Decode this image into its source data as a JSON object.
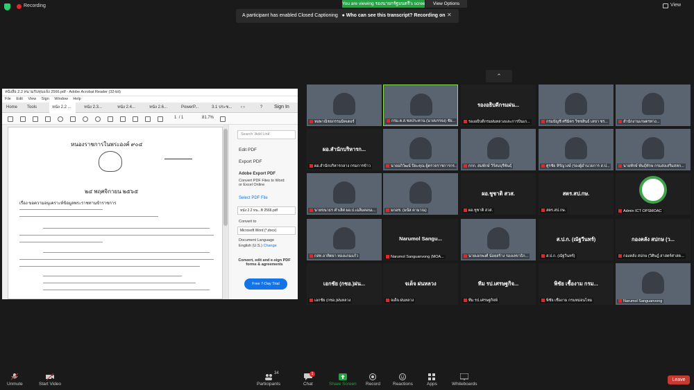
{
  "top": {
    "recording": "Recording",
    "viewing": "You are viewing รองนายกรัฐมนตรี's screen",
    "view_options": "View Options",
    "view": "View",
    "caption_notice": "A participant has enabled Closed Captioning",
    "caption_link": "Who can see this transcript? Recording on"
  },
  "acrobat": {
    "title": "หนังสือ 2.2 หนามรับทุนแจ้ง 2566.pdf - Adobe Acrobat Reader (32-bit)",
    "menu": [
      "File",
      "Edit",
      "View",
      "Sign",
      "Window",
      "Help"
    ],
    "tabs": [
      "Home",
      "Tools",
      "หนัง 2.2 ...",
      "หนัง 2.3...",
      "หนัง 2.4...",
      "หนัง 2.6...",
      "PowerP...",
      "3.1 ประช..."
    ],
    "sign_in": "Sign In",
    "page_current": "1",
    "page_total": "/ 1",
    "zoom": "81.7%",
    "doc_heading": "หนองราชการในพระองค์ ๙๐๔",
    "doc_date": "๒๔ พฤศจิกายน ๒๕๖๕",
    "doc_subject": "เรื่อง ขอความอนุเคราะห์ข้อมูลพระราชทานข้าราชการ",
    "right": {
      "search_placeholder": "Search 'Add Link'",
      "edit_pdf": "Edit PDF",
      "export_pdf": "Export PDF",
      "adobe_export": "Adobe Export PDF",
      "convert_desc": "Convert PDF Files to Word or Excel Online",
      "select_file": "Select PDF File",
      "file_name": "หนัง 2.2 หน...ทิ 2566.pdf",
      "convert_to": "Convert to",
      "format": "Microsoft Word (*.docx)",
      "doc_lang": "Document Language",
      "lang": "English (U.S.)",
      "change": "Change",
      "promo": "Convert, edit and e-sign PDF forms & agreements",
      "free_trial": "Free 7-Day Trial"
    }
  },
  "tiles": [
    {
      "name": "",
      "label": "หอพาณิชยกรรมมิคเตอร์",
      "video": true
    },
    {
      "name": "",
      "label": "กรม.ค.ส.ชลประทาน (นายบรรจง) ชัย...",
      "video": true,
      "highlight": true
    },
    {
      "name": "รองอธิบดีกรมฝน...",
      "label": "รองอธิบดีกรมฝนหลวงและการบินเก..."
    },
    {
      "name": "",
      "label": "กรมบัญชี ศรีมิตร วีชชสินธ์ เลขา ซร...",
      "video": true
    },
    {
      "name": "",
      "label": "สำนักงานเกษตรทาง...",
      "video": true
    },
    {
      "name": "ผอ.สำนักบริหารก...",
      "label": "ผอ.สำนักบริหารกลาง กรมการข้าว"
    },
    {
      "name": "",
      "label": "นายอภิวัฒน์ ปิยะคุณ ผู้ตรวจราชการกร...",
      "video": true
    },
    {
      "name": "",
      "label": "กกก. สมพักษ์ วีร์สมบุรีพันธุ์",
      "video": true
    },
    {
      "name": "",
      "label": "ศูรชัย หิรัญวงษ์ (รองผู้อำนวยการ ส.ป...",
      "video": true
    },
    {
      "name": "",
      "label": "นายทักษ์ พันธุ์ทักษ กรมส่งเสริมสหก...",
      "video": true
    },
    {
      "name": "",
      "label": "นายขนาธร คำเลิศ ผอ.ป.เฉลิมคอนเ...",
      "video": true
    },
    {
      "name": "",
      "label": "มกอช. (มนัส คามาณ)",
      "video": true
    },
    {
      "name": "ผอ.ชูชาติ สวส.",
      "label": "ผอ.ชูชาติ สวส."
    },
    {
      "name": "สตร.สป.กษ.",
      "label": "สตร.สป.กษ."
    },
    {
      "name": "",
      "label": "Admin ICT OPSMOAC",
      "logo": true
    },
    {
      "name": "",
      "label": "กสท.อาทิตยา ทองแกมแก้ว",
      "video": true
    },
    {
      "name": "Narumol Sangu...",
      "label": "Narumol Sanguanvong (MOA..."
    },
    {
      "name": "",
      "label": "นายเอกพงศ์ น้อยสร้าง รองเลขาธิก...",
      "video": true
    },
    {
      "name": "ส.ป.ก. (ณัฐวีนทร์)",
      "label": "ส.ป.ก. (ณัฐวีนทร์)"
    },
    {
      "name": "กองคลัง สปกษ (ว...",
      "label": "กองคลัง สปกษ (วิศิษฎ์ สาสตร์ศาสต..."
    },
    {
      "name": "เอกชัย (กชอ.)ฝน...",
      "label": "เอกชัย (กชอ.)ฝนหลวง"
    },
    {
      "name": "จเด็จ ฝนหลวง",
      "label": "จเด็จ ฝนหลวง"
    },
    {
      "name": "ทีม รป.เศรษฐกิจ...",
      "label": "ทีม รป.เศรษฐกิจพ้"
    },
    {
      "name": "พิชัย เชื้องาม กรม...",
      "label": "พิชัย เชื้องาม กรมหม่อนไหม"
    },
    {
      "name": "",
      "label": "Narumol Sanguanvong",
      "video": true
    }
  ],
  "bottom": {
    "unmute": "Unmute",
    "start_video": "Start Video",
    "participants": "Participants",
    "participants_count": "34",
    "chat": "Chat",
    "chat_badge": "1",
    "share": "Share Screen",
    "record": "Record",
    "reactions": "Reactions",
    "apps": "Apps",
    "whiteboards": "Whiteboards",
    "leave": "Leave"
  },
  "colors": {
    "share_green": "#25a244",
    "leave_red": "#c73a32",
    "accent_blue": "#1473e6"
  }
}
